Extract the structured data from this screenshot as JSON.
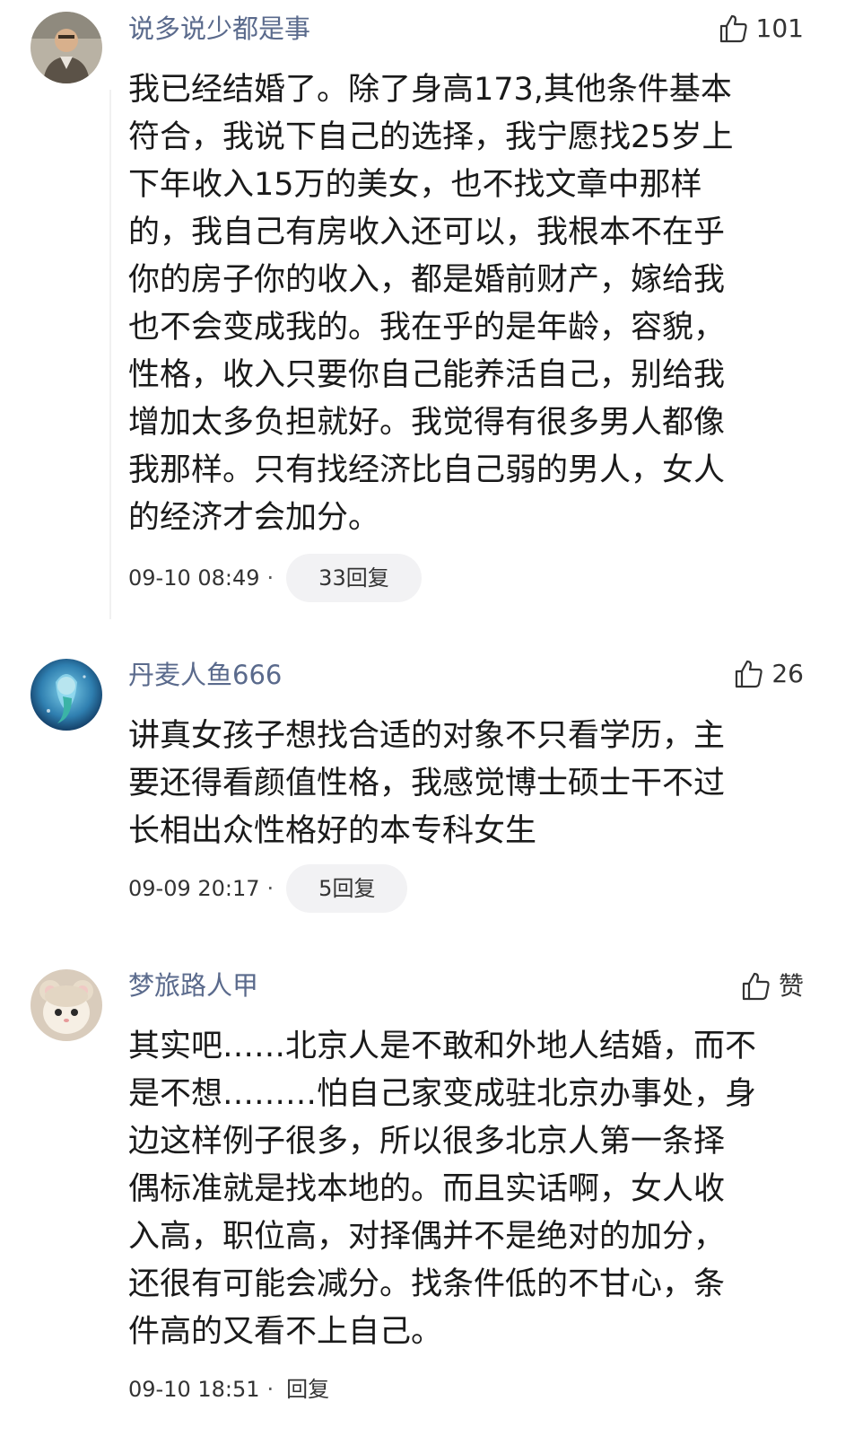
{
  "comments": [
    {
      "username": "说多说少都是事",
      "likes": "101",
      "lines": [
        "我已经结婚了。除了身高173,其他条件基本",
        "符合，我说下自己的选择，我宁愿找25岁上",
        "下年收入15万的美女，也不找文章中那样",
        "的，我自己有房收入还可以，我根本不在乎",
        "你的房子你的收入，都是婚前财产，嫁给我",
        "也不会变成我的。我在乎的是年龄，容貌，",
        "性格，收入只要你自己能养活自己，别给我",
        "增加太多负担就好。我觉得有很多男人都像",
        "我那样。只有找经济比自己弱的男人，女人",
        "的经济才会加分。"
      ],
      "time": "09-10 08:49",
      "reply": "33回复"
    },
    {
      "username": "丹麦人鱼666",
      "likes": "26",
      "lines": [
        "讲真女孩子想找合适的对象不只看学历，主",
        "要还得看颜值性格，我感觉博士硕士干不过",
        "长相出众性格好的本专科女生"
      ],
      "time": "09-09 20:17",
      "reply": "5回复"
    },
    {
      "username": "梦旅路人甲",
      "likes": "赞",
      "lines": [
        "其实吧……北京人是不敢和外地人结婚，而不",
        "是不想………怕自己家变成驻北京办事处，身",
        "边这样例子很多，所以很多北京人第一条择",
        "偶标准就是找本地的。而且实话啊，女人收",
        "入高，职位高，对择偶并不是绝对的加分，",
        "还很有可能会减分。找条件低的不甘心，条",
        "件高的又看不上自己。"
      ],
      "time": "09-10 18:51",
      "reply": "回复"
    }
  ],
  "meta_separator": "·",
  "icons": {
    "like": "thumbs-up-icon"
  }
}
